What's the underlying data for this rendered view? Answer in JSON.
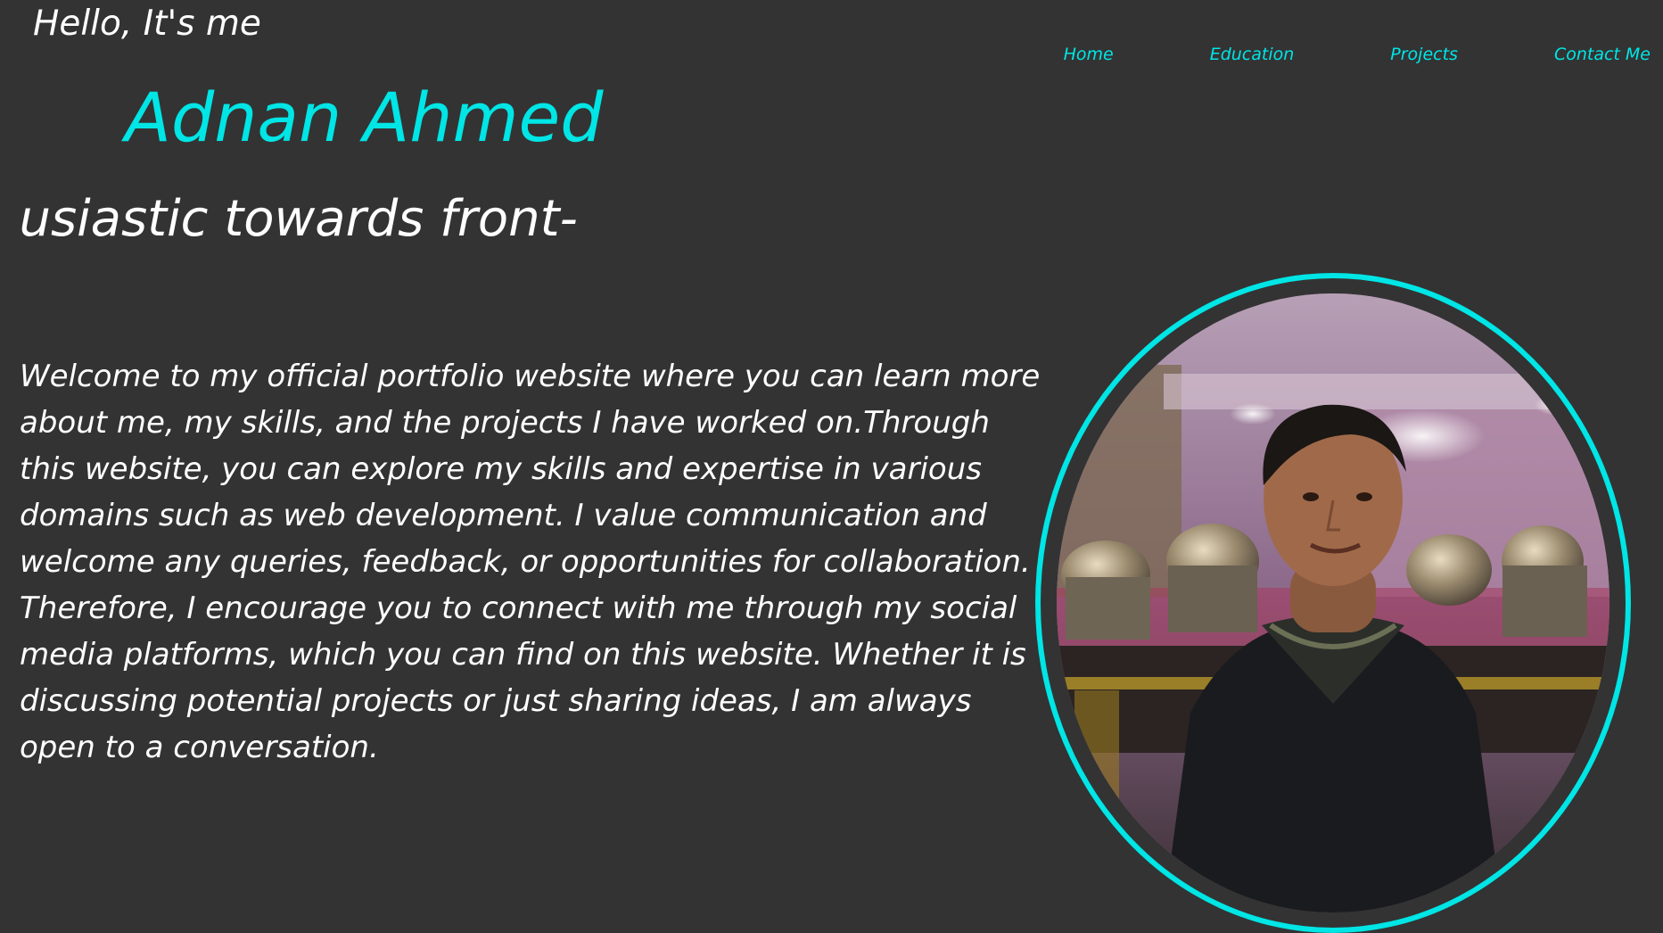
{
  "header": {
    "greeting": "Hello, It's me",
    "name": "Adnan Ahmed",
    "tagline_visible": "thusiastic towards front-"
  },
  "nav": {
    "items": [
      {
        "label": "Home"
      },
      {
        "label": "Education"
      },
      {
        "label": "Projects"
      },
      {
        "label": "Contact Me"
      }
    ]
  },
  "intro": {
    "text": "Welcome to my official portfolio website where you can learn more about me, my skills, and the projects I have worked on.Through this website, you can explore my skills and expertise in various domains such as web development. I value communication and welcome any queries, feedback, or opportunities for collaboration. Therefore, I encourage you to connect with me through my social media platforms, which you can find on this website. Whether it is discussing potential projects or just sharing ideas, I am always open to a conversation."
  },
  "profile": {
    "photo_icon": "profile-photo"
  },
  "colors": {
    "background": "#333333",
    "accent": "#00e5e5",
    "text": "#ffffff"
  }
}
